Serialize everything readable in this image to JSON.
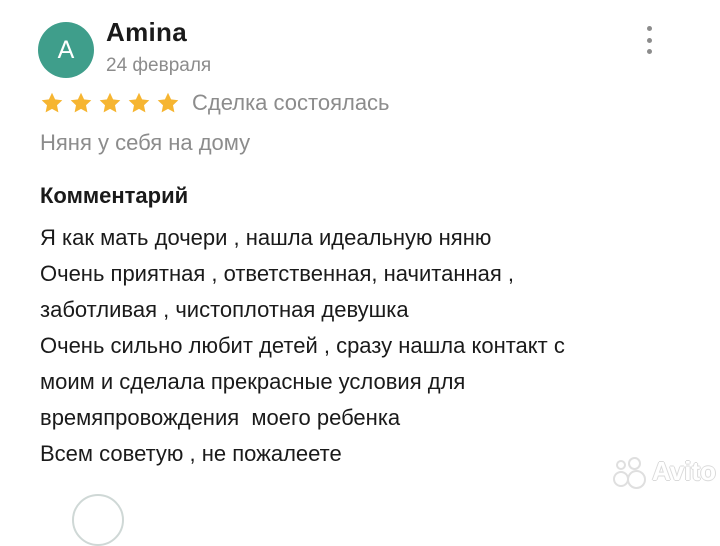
{
  "review": {
    "avatar_letter": "A",
    "avatar_color": "#3f9e8b",
    "author": "Amina",
    "date": "24 февраля",
    "rating": 5,
    "rating_max": 5,
    "star_color": "#f6b531",
    "deal_status": "Сделка состоялась",
    "service": "Няня у себя на дому",
    "comment_title": "Комментарий",
    "comment_lines": [
      "Я как мать дочери , нашла идеальную няню",
      "Очень приятная , ответственная, начитанная ,",
      "заботливая , чистоплотная девушка",
      "Очень сильно любит детей , сразу нашла контакт с",
      "моим и сделала прекрасные условия для",
      "времяпровождения  моего ребенка",
      "Всем советую , не пожалеете"
    ]
  },
  "more_icon": "vertical-dots-icon",
  "watermark": {
    "text": "Avito"
  }
}
